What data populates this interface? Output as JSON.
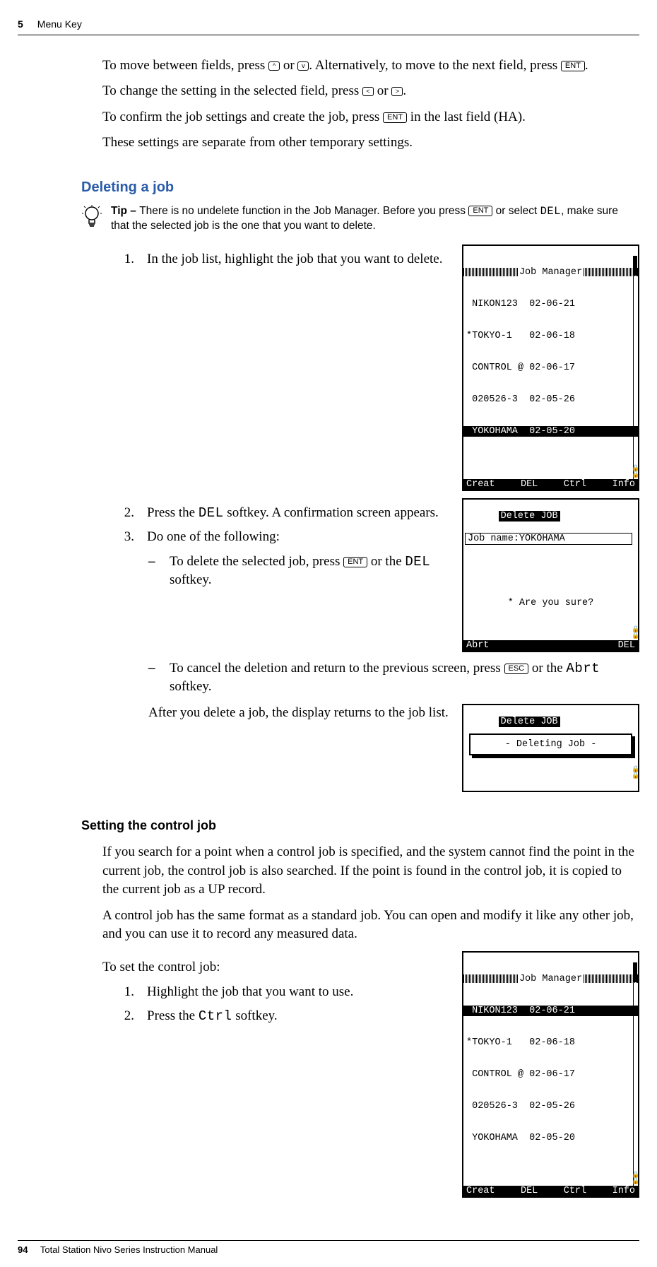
{
  "header": {
    "chapnum": "5",
    "title": "Menu Key"
  },
  "intro": {
    "p1a": "To move between fields, press ",
    "p1b": " or ",
    "p1c": ". Alternatively, to move to the next field, press ",
    "p1d": ".",
    "p2a": "To change the setting in the selected field, press ",
    "p2b": " or ",
    "p2c": ".",
    "p3a": "To confirm the job settings and create the job, press ",
    "p3b": " in the last field (HA).",
    "p4": "These settings are separate from other temporary settings."
  },
  "keys": {
    "up": "^",
    "down": "v",
    "left": "<",
    "right": ">",
    "ent": "ENT",
    "esc": "ESC"
  },
  "del_section": {
    "title": "Deleting a job",
    "tip_label": "Tip – ",
    "tip_a": "There is no undelete function in the Job Manager. Before you press ",
    "tip_b": " or select ",
    "tip_c": ", make sure that the selected job is the one that you want to delete.",
    "tip_del": "DEL",
    "step1": "In the job list, highlight the job that you want to delete.",
    "step2a": "Press the ",
    "step2b": " softkey. A confirmation screen appears.",
    "step2_key": "DEL",
    "step3": "Do one of the following:",
    "d1a": "To delete the selected job, press ",
    "d1b": " or the ",
    "d1c": " softkey.",
    "d1_key": "DEL",
    "d2a": "To cancel the deletion and return to the previous screen, press ",
    "d2b": " or the ",
    "d2c": " softkey.",
    "d2_key": "Abrt",
    "after": "After you delete a job, the display returns to the job list."
  },
  "ctrl_section": {
    "title": "Setting the control job",
    "p1": "If you search for a point when a control job is specified, and the system cannot find the point in the current job, the control job is also searched. If the point is found in the control job, it is copied to the current job as a UP record.",
    "p2": "A control job has the same format as a standard job. You can open and modify it like any other job, and you can use it to record any measured data.",
    "lead": "To set the control job:",
    "step1": "Highlight the job that you want to use.",
    "step2a": "Press the ",
    "step2b": " softkey.",
    "step2_key": "Ctrl"
  },
  "lcd_jobmgr": {
    "title": "Job Manager",
    "rows": [
      " NIKON123  02-06-21",
      "*TOKYO-1   02-06-18",
      " CONTROL @ 02-06-17",
      " 020526-3  02-05-26",
      " YOKOHAMA  02-05-20"
    ],
    "soft": [
      "Creat",
      "DEL",
      "Ctrl",
      "Info"
    ]
  },
  "lcd_jobmgr2": {
    "title": "Job Manager",
    "rows": [
      " NIKON123  02-06-21",
      "*TOKYO-1   02-06-18",
      " CONTROL @ 02-06-17",
      " 020526-3  02-05-26",
      " YOKOHAMA  02-05-20"
    ],
    "soft": [
      "Creat",
      "DEL",
      "Ctrl",
      "Info"
    ]
  },
  "lcd_delconf": {
    "label": "Delete JOB",
    "line": "Job name:YOKOHAMA",
    "prompt": "* Are you sure?",
    "soft_l": "Abrt",
    "soft_r": "DEL"
  },
  "lcd_deleting": {
    "label": "Delete JOB",
    "popup": "- Deleting Job -"
  },
  "footer": {
    "page": "94",
    "manual": "Total Station Nivo Series Instruction Manual"
  }
}
